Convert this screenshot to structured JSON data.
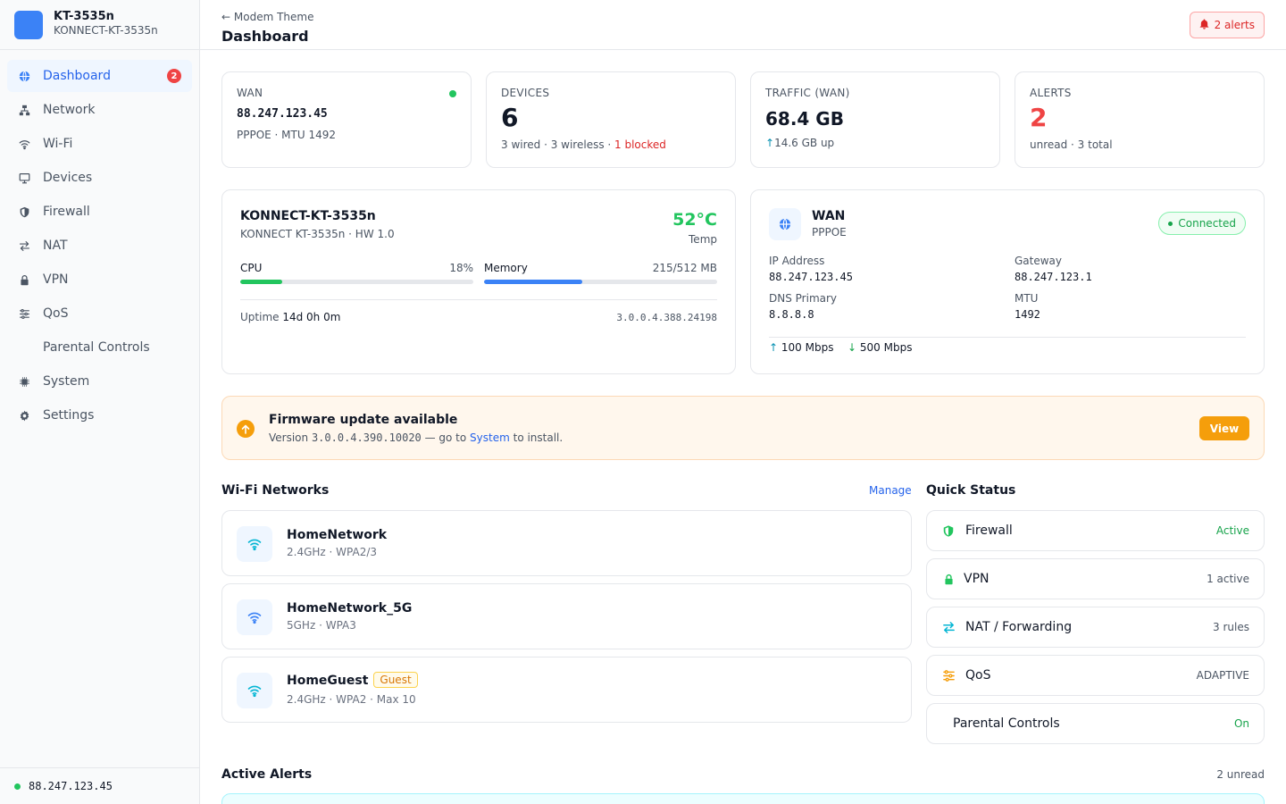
{
  "brand": {
    "name": "KT-3535n",
    "model": "KONNECT-KT-3535n"
  },
  "nav": {
    "items": [
      {
        "label": "Dashboard",
        "icon": "globe-icon",
        "badge": "2",
        "active": true
      },
      {
        "label": "Network",
        "icon": "network-icon"
      },
      {
        "label": "Wi-Fi",
        "icon": "wifi-icon"
      },
      {
        "label": "Devices",
        "icon": "monitor-icon"
      },
      {
        "label": "Firewall",
        "icon": "shield-icon"
      },
      {
        "label": "NAT",
        "icon": "arrows-icon"
      },
      {
        "label": "VPN",
        "icon": "lock-icon"
      },
      {
        "label": "QoS",
        "icon": "sliders-icon"
      },
      {
        "label": "Parental Controls",
        "icon": ""
      },
      {
        "label": "System",
        "icon": "chip-icon"
      },
      {
        "label": "Settings",
        "icon": "gear-icon"
      }
    ]
  },
  "footer": {
    "ip": "88.247.123.45"
  },
  "header": {
    "breadcrumb": "Modem Theme",
    "title": "Dashboard",
    "alerts_label": "2 alerts"
  },
  "stats": {
    "wan": {
      "label": "WAN",
      "ip": "88.247.123.45",
      "sub": "PPPOE · MTU 1492"
    },
    "devices": {
      "label": "DEVICES",
      "value": "6",
      "sub": "3 wired · 3 wireless · ",
      "blocked": "1 blocked"
    },
    "traffic": {
      "label": "TRAFFIC (WAN)",
      "value": "68.4 GB",
      "sub": "14.6 GB up"
    },
    "alerts": {
      "label": "ALERTS",
      "value": "2",
      "sub": "unread · 3 total"
    }
  },
  "router": {
    "name": "KONNECT-KT-3535n",
    "sub": "KONNECT KT-3535n · HW 1.0",
    "temp": "52°C",
    "temp_label": "Temp",
    "cpu_label": "CPU",
    "cpu_value": "18%",
    "cpu_pct": 18,
    "mem_label": "Memory",
    "mem_value": "215/512 MB",
    "mem_pct": 42,
    "uptime_label": "Uptime",
    "uptime": "14d 0h 0m",
    "firmware": "3.0.0.4.388.24198"
  },
  "wan_card": {
    "title": "WAN",
    "proto": "PPPOE",
    "status": "Connected",
    "ip_label": "IP Address",
    "ip": "88.247.123.45",
    "gw_label": "Gateway",
    "gw": "88.247.123.1",
    "dns_label": "DNS Primary",
    "dns": "8.8.8.8",
    "mtu_label": "MTU",
    "mtu": "1492",
    "up": "100 Mbps",
    "down": "500 Mbps"
  },
  "firmware": {
    "title": "Firmware update available",
    "prefix": "Version ",
    "version": "3.0.0.4.390.10020",
    "middle": " — go to ",
    "link": "System",
    "suffix": " to install.",
    "button": "View"
  },
  "wifi": {
    "title": "Wi-Fi Networks",
    "manage": "Manage",
    "networks": [
      {
        "name": "HomeNetwork",
        "meta": "2.4GHz  ·  WPA2/3",
        "color": "#06b6d4"
      },
      {
        "name": "HomeNetwork_5G",
        "meta": "5GHz  ·  WPA3",
        "color": "#3b82f6"
      },
      {
        "name": "HomeGuest",
        "tag": "Guest",
        "meta": "2.4GHz  ·  WPA2  ·  Max 10",
        "color": "#06b6d4"
      }
    ]
  },
  "quick": {
    "title": "Quick Status",
    "items": [
      {
        "label": "Firewall",
        "value": "Active",
        "icon": "shield-icon",
        "value_color": "#16a34a"
      },
      {
        "label": "VPN",
        "value": "1 active",
        "icon": "lock-icon",
        "value_color": "#4b5563"
      },
      {
        "label": "NAT / Forwarding",
        "value": "3 rules",
        "icon": "arrows-icon",
        "value_color": "#4b5563"
      },
      {
        "label": "QoS",
        "value": "ADAPTIVE",
        "icon": "sliders-icon",
        "value_color": "#4b5563"
      },
      {
        "label": "Parental Controls",
        "value": "On",
        "icon": "",
        "value_color": "#16a34a"
      }
    ]
  },
  "alerts_section": {
    "title": "Active Alerts",
    "count": "2 unread"
  },
  "colors": {
    "accent": "#3b82f6",
    "success": "#22c55e",
    "danger": "#ef4444",
    "warning": "#f59e0b",
    "cyan": "#06b6d4"
  }
}
